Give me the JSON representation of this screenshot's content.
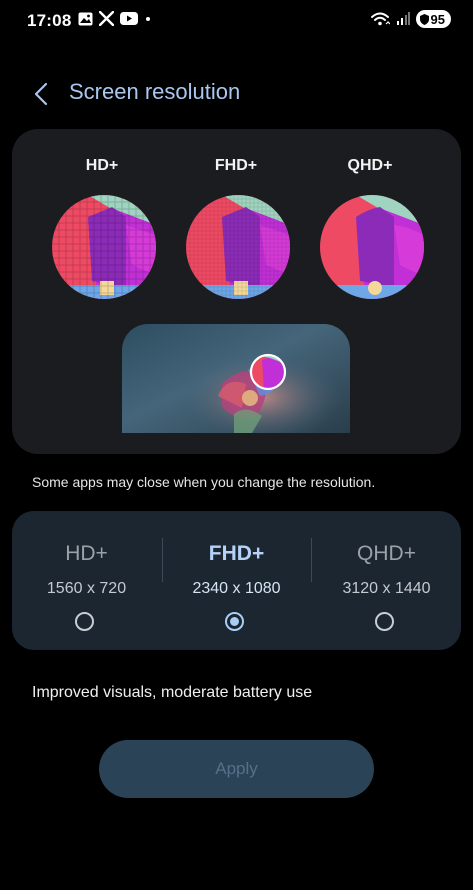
{
  "status_bar": {
    "time": "17:08",
    "battery": "95"
  },
  "header": {
    "title": "Screen resolution"
  },
  "preview": {
    "labels": [
      "HD+",
      "FHD+",
      "QHD+"
    ]
  },
  "note": "Some apps may close when you change the resolution.",
  "options": [
    {
      "name": "HD+",
      "resolution": "1560 x 720",
      "selected": false
    },
    {
      "name": "FHD+",
      "resolution": "2340 x 1080",
      "selected": true
    },
    {
      "name": "QHD+",
      "resolution": "3120 x 1440",
      "selected": false
    }
  ],
  "description": "Improved visuals, moderate battery use",
  "apply_label": "Apply",
  "colors": {
    "accent": "#a9cdf5",
    "card": "#1b1c20",
    "options_card": "#1c2630",
    "apply_bg": "#2b4357"
  }
}
